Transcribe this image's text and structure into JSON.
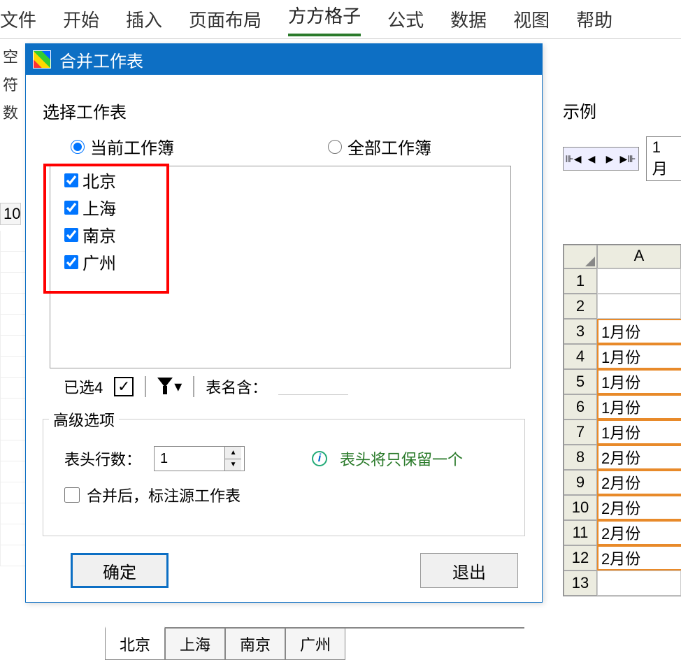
{
  "ribbon": {
    "tabs": [
      "文件",
      "开始",
      "插入",
      "页面布局",
      "方方格子",
      "公式",
      "数据",
      "视图",
      "帮助"
    ],
    "active_index": 4
  },
  "bg_left": {
    "items": [
      "空",
      "符",
      "数"
    ],
    "row_marker": "10"
  },
  "dialog": {
    "title": "合并工作表",
    "select_label": "选择工作表",
    "radio_current": "当前工作簿",
    "radio_all": "全部工作簿",
    "radio_selected": "current",
    "sheets": [
      {
        "name": "北京",
        "checked": true
      },
      {
        "name": "上海",
        "checked": true
      },
      {
        "name": "南京",
        "checked": true
      },
      {
        "name": "广州",
        "checked": true
      }
    ],
    "selected_count_label": "已选4",
    "checkall_symbol": "✓",
    "filter_dropdown": "▾",
    "name_contains_label": "表名含：",
    "name_contains_value": "",
    "advanced_label": "高级选项",
    "header_rows_label": "表头行数：",
    "header_rows_value": "1",
    "hint_text": "表头将只保留一个",
    "mark_source_label": "合并后，标注源工作表",
    "mark_source_checked": false,
    "ok_label": "确定",
    "cancel_label": "退出"
  },
  "example": {
    "label": "示例",
    "nav_symbols": [
      "⊪◀",
      "◀",
      "▶",
      "▶⊪"
    ],
    "sheet_name": "1月",
    "col_header": "A",
    "rows": [
      {
        "n": "1",
        "v": ""
      },
      {
        "n": "2",
        "v": ""
      },
      {
        "n": "3",
        "v": "1月份",
        "hl": true
      },
      {
        "n": "4",
        "v": "1月份",
        "hl": true
      },
      {
        "n": "5",
        "v": "1月份",
        "hl": true
      },
      {
        "n": "6",
        "v": "1月份",
        "hl": true
      },
      {
        "n": "7",
        "v": "1月份",
        "hl": true
      },
      {
        "n": "8",
        "v": "2月份",
        "hl": true
      },
      {
        "n": "9",
        "v": "2月份",
        "hl": true
      },
      {
        "n": "10",
        "v": "2月份",
        "hl": true
      },
      {
        "n": "11",
        "v": "2月份",
        "hl": true
      },
      {
        "n": "12",
        "v": "2月份",
        "hl": true
      },
      {
        "n": "13",
        "v": ""
      }
    ]
  },
  "bottom_tabs": {
    "items": [
      "北京",
      "上海",
      "南京",
      "广州"
    ],
    "active_index": 0
  }
}
